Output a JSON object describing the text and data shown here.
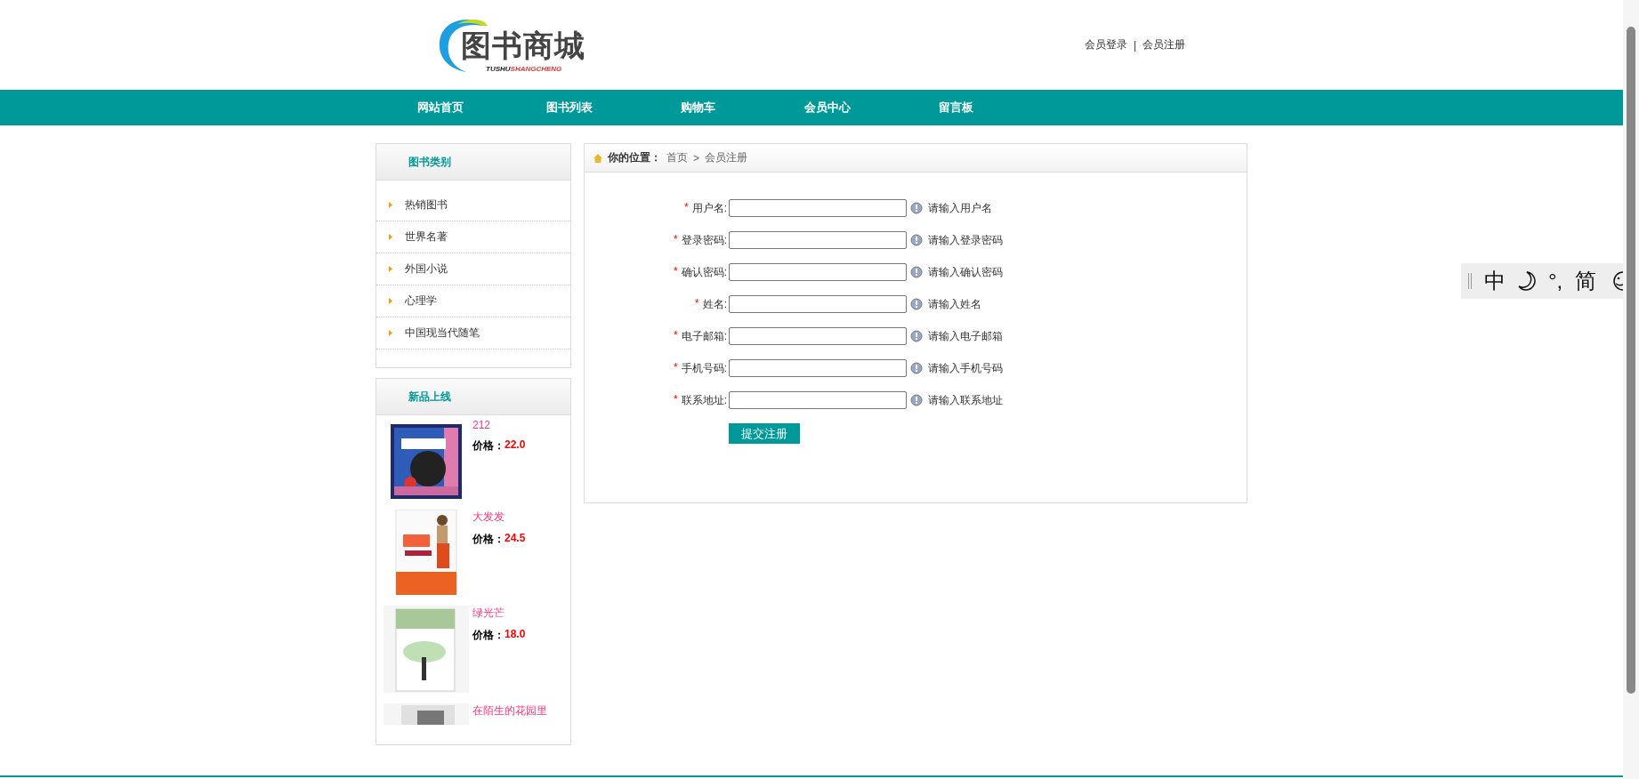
{
  "header": {
    "logo": {
      "title": "图书商城",
      "sub_1": "TUSHU",
      "sub_2": "SHANGCHENG"
    },
    "links": [
      "会员登录",
      "会员注册"
    ],
    "separator": "|"
  },
  "nav": [
    "网站首页",
    "图书列表",
    "购物车",
    "会员中心",
    "留言板"
  ],
  "categories": {
    "title": "图书类别",
    "items": [
      "热销图书",
      "世界名著",
      "外国小说",
      "心理学",
      "中国现当代随笔"
    ]
  },
  "new_books": {
    "title": "新品上线",
    "items": [
      {
        "kind": "cookie",
        "title": "212",
        "price_label": "价格：",
        "price": "22.0"
      },
      {
        "kind": "portrait",
        "title": "大发发",
        "price_label": "价格：",
        "price": "24.5"
      },
      {
        "kind": "tree",
        "title": "绿光芒",
        "price_label": "价格：",
        "price": "18.0"
      },
      {
        "kind": "grey",
        "title": "在陌生的花园里"
      }
    ]
  },
  "breadcrumb": {
    "label": "你的位置：",
    "home": "首页",
    "sep": ">",
    "current": "会员注册"
  },
  "form": {
    "fields": [
      {
        "required": true,
        "label": "用户名:",
        "hint": "请输入用户名"
      },
      {
        "required": true,
        "label": "登录密码:",
        "hint": "请输入登录密码"
      },
      {
        "required": true,
        "label": "确认密码:",
        "hint": "请输入确认密码"
      },
      {
        "required": true,
        "label": "姓名:",
        "hint": "请输入姓名"
      },
      {
        "required": true,
        "label": "电子邮箱:",
        "hint": "请输入电子邮箱"
      },
      {
        "required": true,
        "label": "手机号码:",
        "hint": "请输入手机号码"
      },
      {
        "required": true,
        "label": "联系地址:",
        "hint": "请输入联系地址"
      }
    ],
    "submit": "提交注册",
    "required_mark": "*"
  },
  "ime_toolbar": [
    "中",
    "°,",
    "简"
  ]
}
